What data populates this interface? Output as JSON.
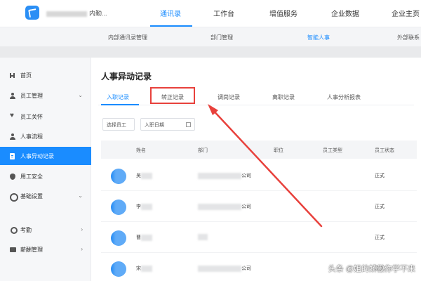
{
  "header": {
    "org_name": "内勤...",
    "tabs": [
      {
        "label": "通讯录",
        "active": true
      },
      {
        "label": "工作台",
        "active": false
      },
      {
        "label": "增值服务",
        "active": false
      },
      {
        "label": "企业数据",
        "active": false
      },
      {
        "label": "企业主页",
        "active": false
      }
    ]
  },
  "subnav": {
    "items": [
      {
        "label": "内部通讯录管理",
        "active": false
      },
      {
        "label": "部门管理",
        "active": false
      },
      {
        "label": "智能人事",
        "active": true
      },
      {
        "label": "外部联系",
        "active": false
      }
    ]
  },
  "sidebar": {
    "items": [
      {
        "label": "首页",
        "icon": "home-icon",
        "arrow": ""
      },
      {
        "label": "员工管理",
        "icon": "user-icon",
        "arrow": "⌄"
      },
      {
        "label": "员工关怀",
        "icon": "heart-icon",
        "arrow": ""
      },
      {
        "label": "人事流程",
        "icon": "user-icon",
        "arrow": ""
      },
      {
        "label": "人事异动记录",
        "icon": "record-icon",
        "arrow": "",
        "active": true
      },
      {
        "label": "用工安全",
        "icon": "shield-icon",
        "arrow": ""
      },
      {
        "label": "基础设置",
        "icon": "gear-icon",
        "arrow": "⌄"
      },
      {
        "label": "考勤",
        "icon": "person-icon",
        "arrow": "›"
      },
      {
        "label": "薪酬管理",
        "icon": "salary-icon",
        "arrow": "›"
      }
    ]
  },
  "main": {
    "title": "人事异动记录",
    "tabs": [
      {
        "label": "入职记录",
        "active": true
      },
      {
        "label": "转正记录",
        "active": false,
        "highlighted": true
      },
      {
        "label": "调岗记录",
        "active": false
      },
      {
        "label": "离职记录",
        "active": false
      },
      {
        "label": "人事分析报表",
        "active": false
      }
    ],
    "filters": {
      "employee": "选择员工",
      "date": "入职日期"
    },
    "table": {
      "columns": [
        "姓名",
        "部门",
        "职位",
        "员工类型",
        "员工状态"
      ],
      "rows": [
        {
          "name": "吴",
          "dept_suffix": "公司",
          "status": "正式"
        },
        {
          "name": "李",
          "dept_suffix": "公司",
          "status": "正式"
        },
        {
          "name": "曹",
          "dept_suffix": "",
          "status": "正式"
        },
        {
          "name": "宋",
          "dept_suffix": "公司",
          "status": "正式"
        }
      ]
    }
  },
  "watermark": "头条 @姐的娇傲你学不来",
  "colors": {
    "accent": "#1a8cff",
    "highlight_red": "#e8413c"
  }
}
